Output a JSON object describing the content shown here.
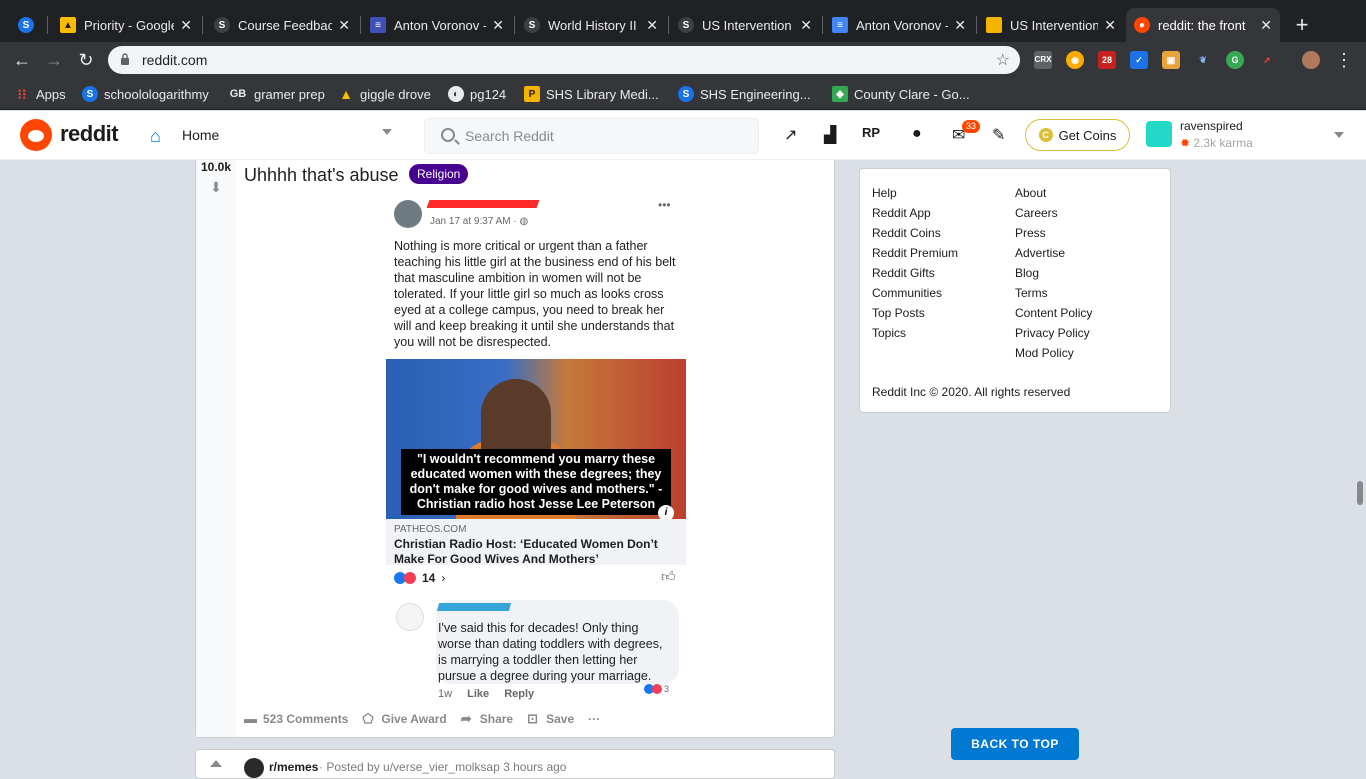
{
  "browser": {
    "tabs": [
      {
        "title": "",
        "favicon": "schoology-icon",
        "color": "#1a73e8"
      },
      {
        "title": "Priority - Google",
        "favicon": "drive-icon",
        "color": "#fbbc04"
      },
      {
        "title": "Course Feedback",
        "favicon": "schoology-icon",
        "color": "#3c4043"
      },
      {
        "title": "Anton Voronov -",
        "favicon": "docs-icon",
        "color": "#3f51b5"
      },
      {
        "title": "World History II",
        "favicon": "schoology-icon",
        "color": "#3c4043"
      },
      {
        "title": "US Intervention",
        "favicon": "schoology-icon",
        "color": "#3c4043"
      },
      {
        "title": "Anton Voronov -",
        "favicon": "docs-icon",
        "color": "#4285f4"
      },
      {
        "title": "US Intervention",
        "favicon": "slides-icon",
        "color": "#f4b400"
      },
      {
        "title": "reddit: the front",
        "favicon": "reddit-icon",
        "color": "#ff4500"
      }
    ],
    "url": "reddit.com",
    "bookmarks": [
      {
        "label": "Apps",
        "icon": "apps-grid-icon"
      },
      {
        "label": "schoolologarithmy",
        "icon": "schoology-icon"
      },
      {
        "label": "gramer prep",
        "icon": "gb-icon"
      },
      {
        "label": "giggle drove",
        "icon": "drive-icon"
      },
      {
        "label": "pg124",
        "icon": "globe-icon"
      },
      {
        "label": "SHS Library Medi...",
        "icon": "library-icon"
      },
      {
        "label": "SHS Engineering...",
        "icon": "schoology-icon"
      },
      {
        "label": "County Clare - Go...",
        "icon": "maps-icon"
      }
    ],
    "extension_badge": "28"
  },
  "reddit_header": {
    "wordmark": "reddit",
    "home_label": "Home",
    "search_placeholder": "Search Reddit",
    "mail_badge": "33",
    "get_coins": "Get Coins",
    "username": "ravenspired",
    "karma": "2.3k karma"
  },
  "post": {
    "score": "10.0k",
    "title": "Uhhhh that's abuse",
    "flair": "Religion",
    "flair_color": "#46018e",
    "fb_date": "Jan 17 at 9:37 AM · ",
    "fb_text": "Nothing is more critical or urgent than a father teaching his little girl at the business end of his belt that masculine ambition in women will not be tolerated. If your little girl so much as looks cross eyed at a college campus, you need to break her will and keep breaking it until she understands that you will not be disrespected.",
    "image_caption": "\"I wouldn't recommend you marry these educated women with these degrees; they don't make for good wives and mothers.\" - Christian radio host Jesse Lee Peterson",
    "link_domain": "PATHEOS.COM",
    "link_title": "Christian Radio Host: ‘Educated Women Don’t Make For Good Wives And Mothers’",
    "reaction_count": "14",
    "comment_text": "I've said this for decades! Only thing worse than dating toddlers with degrees, is marrying a toddler then letting her pursue a degree during your marriage.",
    "comment_time": "1w",
    "comment_like": "Like",
    "comment_reply": "Reply",
    "comment_reactions": "3",
    "actions": {
      "comments": "523 Comments",
      "award": "Give Award",
      "share": "Share",
      "save": "Save",
      "more": "···"
    }
  },
  "next_post": {
    "subreddit": "r/memes",
    "meta": "· Posted by u/verse_vier_molksap 3 hours ago"
  },
  "sidebar": {
    "left_links": [
      "Help",
      "Reddit App",
      "Reddit Coins",
      "Reddit Premium",
      "Reddit Gifts",
      "Communities",
      "Top Posts",
      "Topics"
    ],
    "right_links": [
      "About",
      "Careers",
      "Press",
      "Advertise",
      "Blog",
      "Terms",
      "Content Policy",
      "Privacy Policy",
      "Mod Policy"
    ],
    "copyright": "Reddit Inc © 2020. All rights reserved"
  },
  "back_to_top": "BACK TO TOP"
}
